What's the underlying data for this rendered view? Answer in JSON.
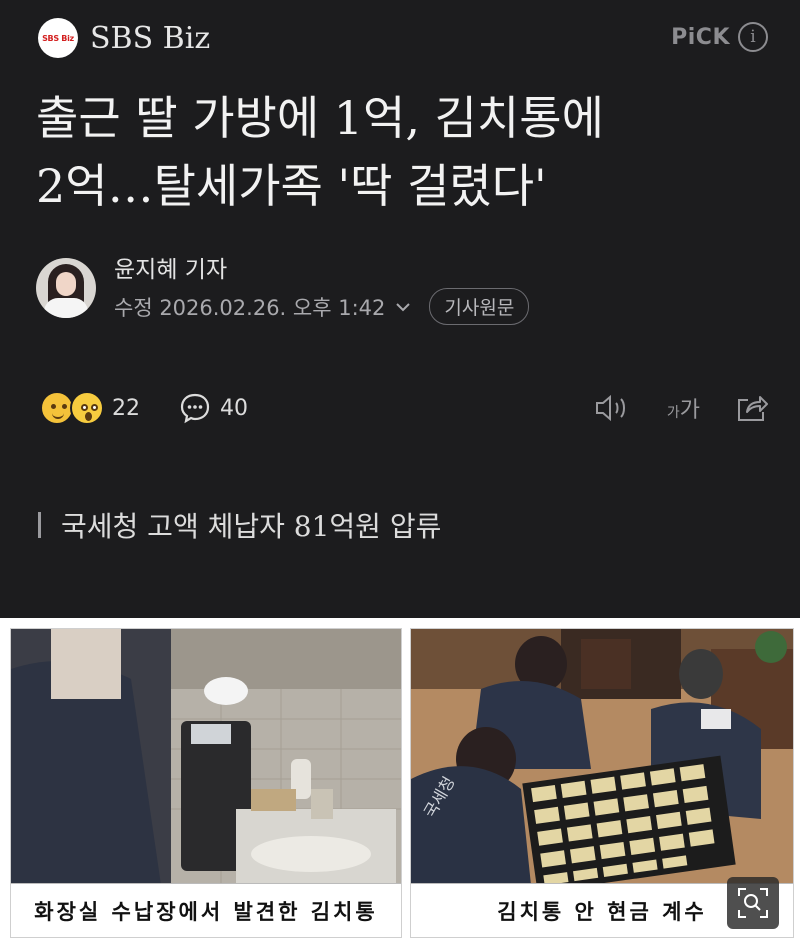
{
  "brand": {
    "name": "SBS Biz",
    "logo_text": "SBS Biz"
  },
  "pick": {
    "label": "PiCK",
    "info_icon": "info-icon"
  },
  "article": {
    "headline_line1": "출근 딸 가방에 1억, 김치통에",
    "headline_line2": "2억…탈세가족 '딱 걸렸다'",
    "reporter": "윤지혜 기자",
    "timestamp": "수정 2026.02.26. 오후 1:42",
    "origin_button": "기사원문",
    "subtitle": "국세청 고액 체납자 81억원 압류"
  },
  "reactions": {
    "count": "22",
    "comment_count": "40"
  },
  "toolbar": {
    "font_size_label_small": "가",
    "font_size_label_large": "가"
  },
  "photos": {
    "left_caption": "화장실 수납장에서 발견한 김치통",
    "right_caption": "김치통 안 현금 계수",
    "vest_text": "국세청"
  }
}
